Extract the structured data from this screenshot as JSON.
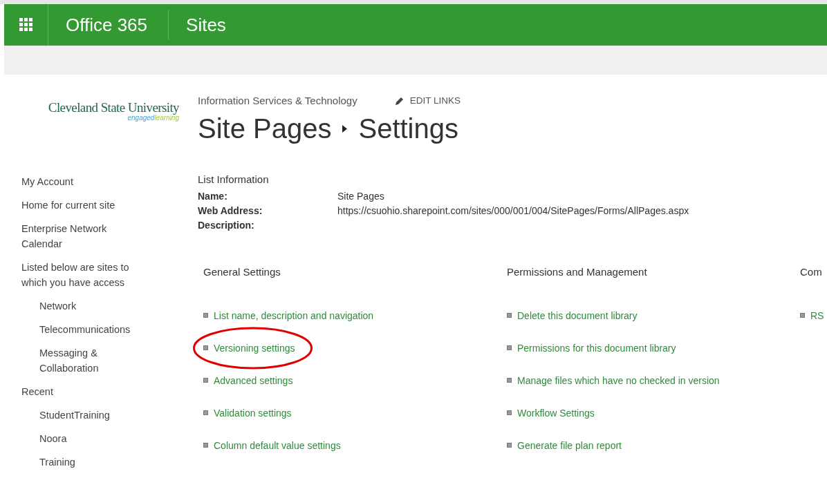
{
  "suite_bar": {
    "app_name": "Office 365",
    "section": "Sites"
  },
  "logo": {
    "name": "Cleveland State University",
    "tagline_part_1": "engaged",
    "tagline_part_2": "learning"
  },
  "sidebar": {
    "items": [
      {
        "label": "My Account"
      },
      {
        "label": "Home for current site"
      },
      {
        "label": "Enterprise Network Calendar"
      },
      {
        "label": "Listed below are sites to which you have access",
        "children": [
          {
            "label": "Network"
          },
          {
            "label": "Telecommunications"
          },
          {
            "label": "Messaging & Collaboration"
          }
        ]
      },
      {
        "label": "Recent",
        "children": [
          {
            "label": "StudentTraining"
          },
          {
            "label": "Noora"
          },
          {
            "label": "Training"
          }
        ]
      }
    ]
  },
  "breadcrumb": {
    "site": "Information Services & Technology",
    "edit_links": "EDIT LINKS",
    "title_part_1": "Site Pages",
    "title_part_2": "Settings"
  },
  "list_information": {
    "heading": "List Information",
    "fields": [
      {
        "label": "Name:",
        "value": "Site Pages"
      },
      {
        "label": "Web Address:",
        "value": "https://csuohio.sharepoint.com/sites/000/001/004/SitePages/Forms/AllPages.aspx"
      },
      {
        "label": "Description:"
      }
    ]
  },
  "sections": [
    {
      "heading": "General Settings",
      "links": [
        {
          "label": "List name, description and navigation",
          "highlighted": false
        },
        {
          "label": "Versioning settings",
          "highlighted": true
        },
        {
          "label": "Advanced settings",
          "highlighted": false
        },
        {
          "label": "Validation settings",
          "highlighted": false
        },
        {
          "label": "Column default value settings",
          "highlighted": false
        }
      ]
    },
    {
      "heading": "Permissions and Management",
      "links": [
        {
          "label": "Delete this document library",
          "highlighted": false
        },
        {
          "label": "Permissions for this document library",
          "highlighted": false
        },
        {
          "label": "Manage files which have no checked in version",
          "highlighted": false
        },
        {
          "label": "Workflow Settings",
          "highlighted": false
        },
        {
          "label": "Generate file plan report",
          "highlighted": false
        }
      ]
    },
    {
      "heading": "Com",
      "links": [
        {
          "label": "RS",
          "highlighted": false
        }
      ]
    }
  ]
}
